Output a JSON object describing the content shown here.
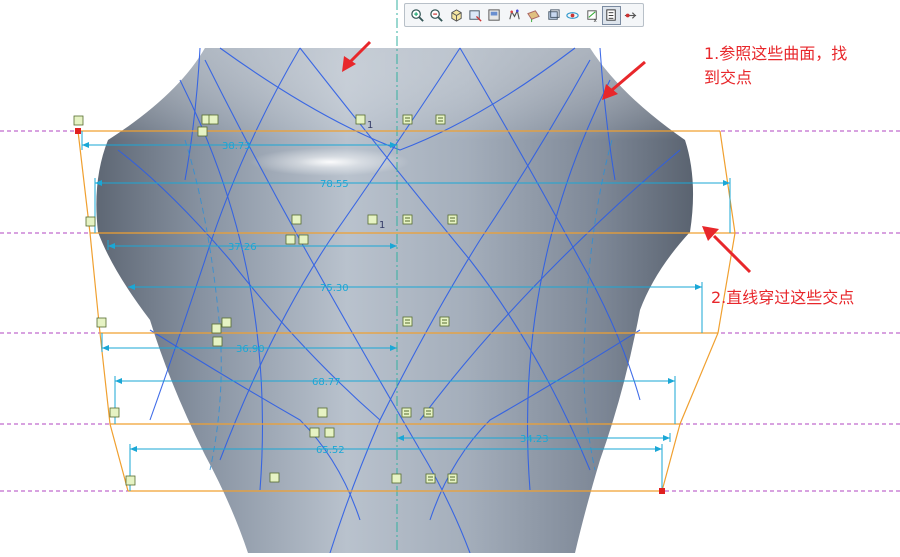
{
  "toolbar": {
    "buttons": [
      {
        "icon": "zoom-in-icon",
        "active": false
      },
      {
        "icon": "zoom-out-icon",
        "active": false
      },
      {
        "icon": "refit-icon",
        "active": false
      },
      {
        "icon": "reorient-icon",
        "active": false
      },
      {
        "icon": "saved-views-icon",
        "active": false
      },
      {
        "icon": "display-style-icon",
        "active": false
      },
      {
        "icon": "datum-display-icon",
        "active": false
      },
      {
        "icon": "annotation-display-icon",
        "active": false
      },
      {
        "icon": "spin-center-icon",
        "active": false
      },
      {
        "icon": "sketch-view-icon",
        "active": false
      },
      {
        "icon": "sketcher-display-icon",
        "active": true
      },
      {
        "icon": "constraints-display-icon",
        "active": false
      }
    ]
  },
  "annotations": {
    "note1_line1": "1.参照这些曲面，找",
    "note1_line2": "到交点",
    "note2": "2.直线穿过这些交点"
  },
  "dimensions": {
    "d1": "38.73",
    "d2": "78.55",
    "d3": "37.26",
    "d4": "75.30",
    "d5": "36.90",
    "d6": "68.77",
    "d7": "34.23",
    "d8": "65.52"
  },
  "constraint_index": {
    "a": "1",
    "b": "1"
  },
  "colors": {
    "vase_body": "#8d98a6",
    "curve_blue": "#2d5ee6",
    "sketch_orange": "#f0a030",
    "dimension_cyan": "#1aa7d6",
    "datum_magenta": "#b044c0",
    "annotation_red": "#e8272b"
  }
}
